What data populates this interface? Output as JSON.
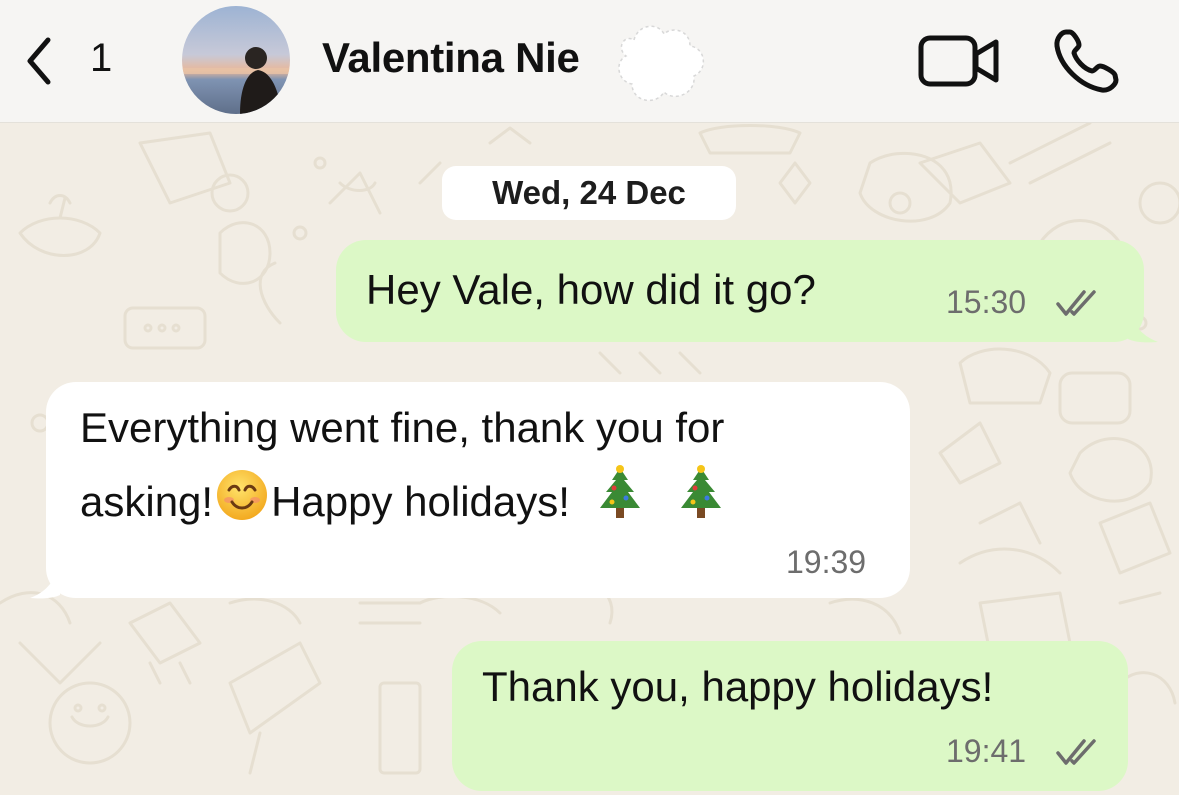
{
  "header": {
    "back_count": "1",
    "contact_name": "Valentina Nie"
  },
  "icons": {
    "back": "chevron-left-icon",
    "video": "video-camera-icon",
    "call": "phone-icon",
    "read_receipt": "double-check-icon",
    "smile": "smiling-face-emoji",
    "tree": "christmas-tree-emoji"
  },
  "colors": {
    "outgoing_bubble": "#dcf8c6",
    "incoming_bubble": "#ffffff",
    "wallpaper": "#f2ede4",
    "header_bg": "#f6f5f3"
  },
  "date_chip": "Wed, 24 Dec",
  "messages": [
    {
      "direction": "outgoing",
      "text": "Hey Vale, how did it go?",
      "time": "15:30",
      "status": "read"
    },
    {
      "direction": "incoming",
      "line1": "Everything went fine, thank you for",
      "line2_a": "asking!",
      "line2_b": "Happy holidays!",
      "time": "19:39"
    },
    {
      "direction": "outgoing",
      "text": "Thank you, happy holidays!",
      "time": "19:41",
      "status": "read"
    }
  ]
}
